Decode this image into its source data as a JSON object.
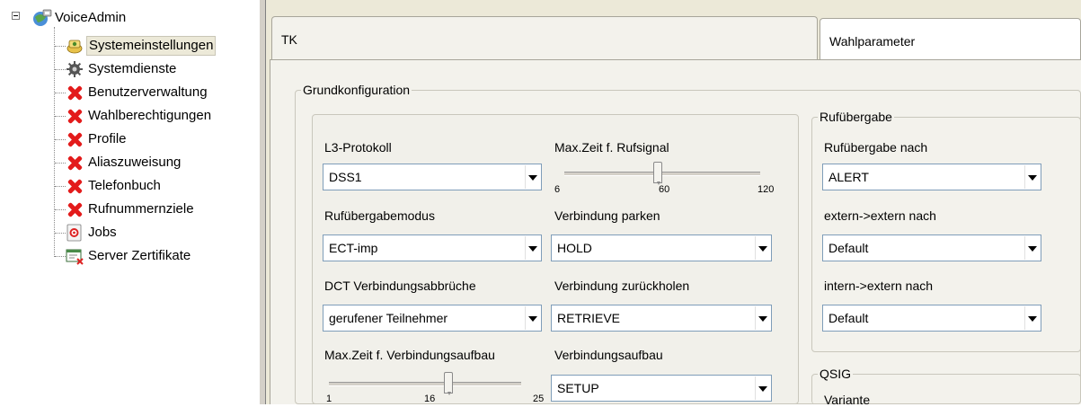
{
  "tree": {
    "root": "VoiceAdmin",
    "items": [
      {
        "label": "Systemeinstellungen",
        "icon": "settings-icon",
        "selected": true
      },
      {
        "label": "Systemdienste",
        "icon": "gear-icon",
        "selected": false
      },
      {
        "label": "Benutzerverwaltung",
        "icon": "red-x-icon",
        "selected": false
      },
      {
        "label": "Wahlberechtigungen",
        "icon": "red-x-icon",
        "selected": false
      },
      {
        "label": "Profile",
        "icon": "red-x-icon",
        "selected": false
      },
      {
        "label": "Aliaszuweisung",
        "icon": "red-x-icon",
        "selected": false
      },
      {
        "label": "Telefonbuch",
        "icon": "red-x-icon",
        "selected": false
      },
      {
        "label": "Rufnummernziele",
        "icon": "red-x-icon",
        "selected": false
      },
      {
        "label": "Jobs",
        "icon": "target-icon",
        "selected": false
      },
      {
        "label": "Server Zertifikate",
        "icon": "certificate-icon",
        "selected": false
      }
    ]
  },
  "tabs": [
    {
      "label": "TK",
      "active": true
    },
    {
      "label": "Wahlparameter",
      "active": false
    }
  ],
  "grundkonfiguration": {
    "title": "Grundkonfiguration",
    "l3_protokoll": {
      "label": "L3-Protokoll",
      "value": "DSS1"
    },
    "max_zeit_rufsignal": {
      "label": "Max.Zeit f. Rufsignal",
      "min": "6",
      "mid": "60",
      "max": "120",
      "value": 60,
      "range": [
        6,
        120
      ]
    },
    "rufuebergabemodus": {
      "label": "Rufübergabemodus",
      "value": "ECT-imp"
    },
    "verbindung_parken": {
      "label": "Verbindung parken",
      "value": "HOLD"
    },
    "dct_abbrueche": {
      "label": "DCT Verbindungsabbrüche",
      "value": "gerufener Teilnehmer"
    },
    "verbindung_zurueckholen": {
      "label": "Verbindung zurückholen",
      "value": "RETRIEVE"
    },
    "max_zeit_aufbau": {
      "label": "Max.Zeit f. Verbindungsaufbau",
      "min": "1",
      "mid": "16",
      "max": "25",
      "value": 16,
      "range": [
        1,
        25
      ]
    },
    "verbindungsaufbau": {
      "label": "Verbindungsaufbau",
      "value": "SETUP"
    }
  },
  "rufuebergabe": {
    "title": "Rufübergabe",
    "nach": {
      "label": "Rufübergabe nach",
      "value": "ALERT"
    },
    "extern_extern": {
      "label": "extern->extern nach",
      "value": "Default"
    },
    "intern_extern": {
      "label": "intern->extern nach",
      "value": "Default"
    }
  },
  "qsig": {
    "title": "QSIG",
    "variante_label": "Variante"
  }
}
